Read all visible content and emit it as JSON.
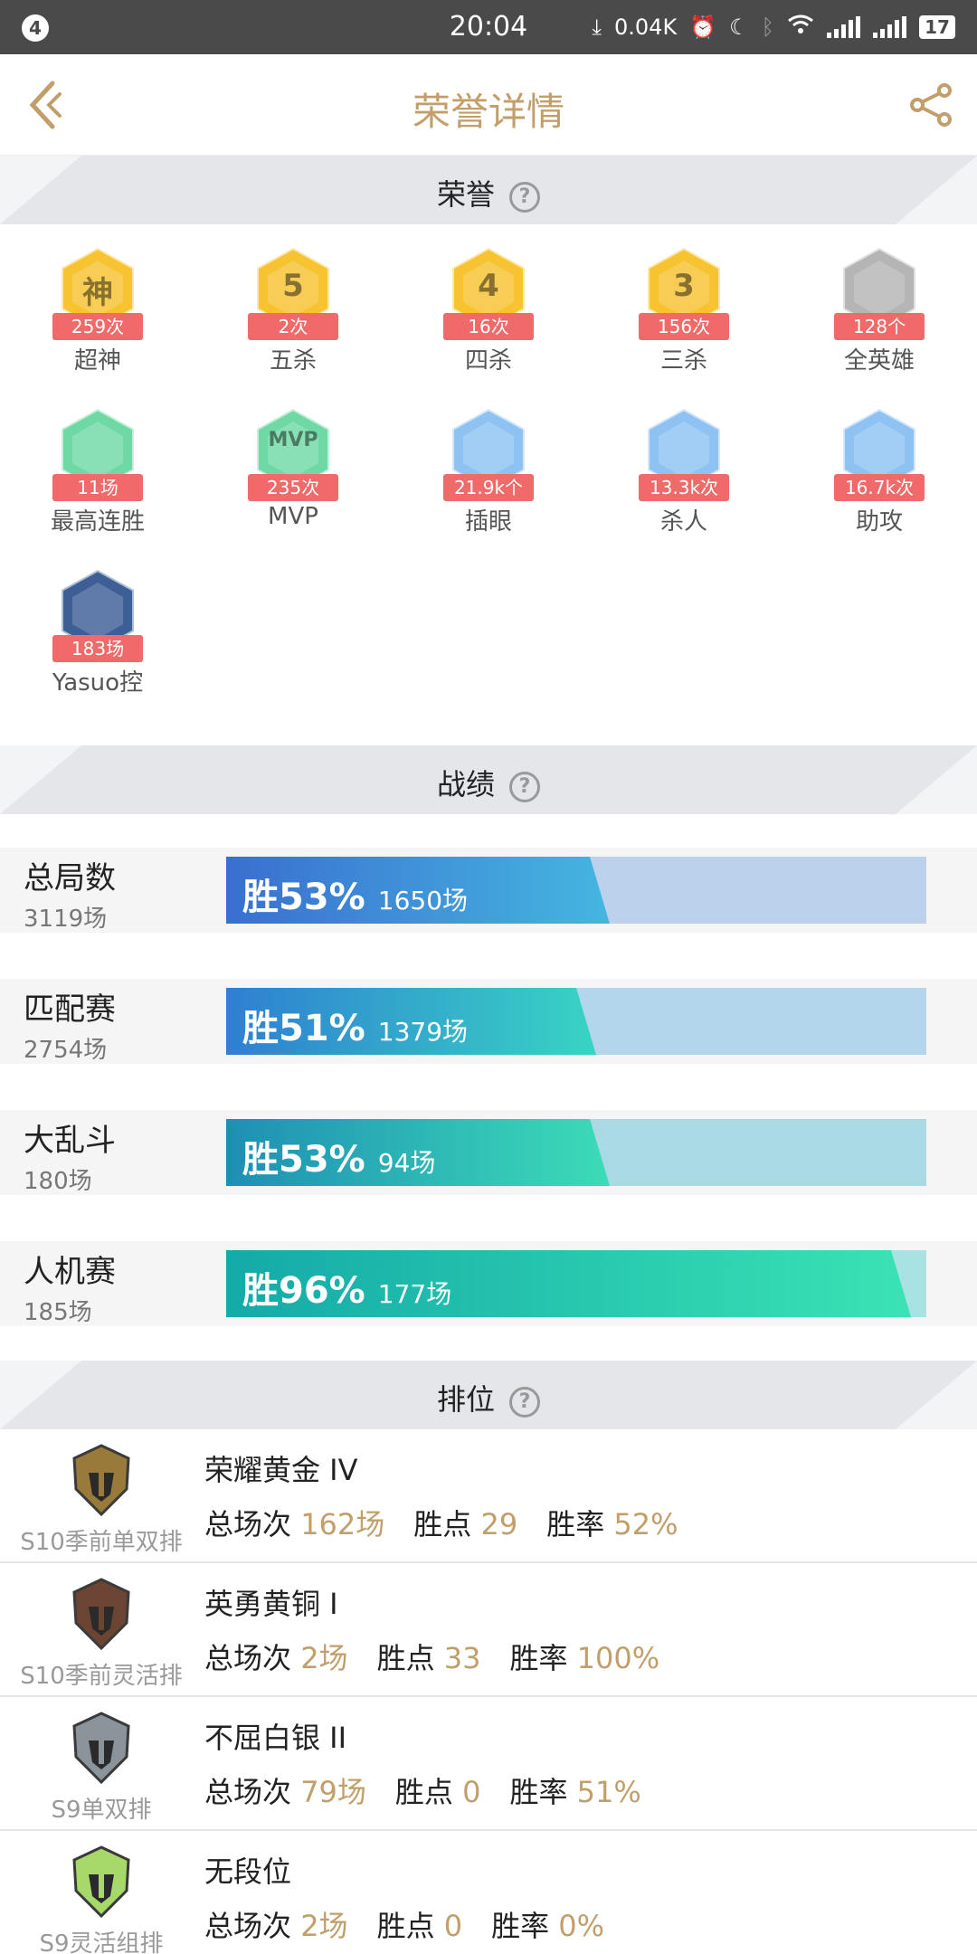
{
  "status_bar": {
    "notification_count": "4",
    "time": "20:04",
    "net_speed": "0.04K",
    "battery": "17",
    "icons": [
      "download-arrow-icon",
      "alarm-icon",
      "moon-icon",
      "bluetooth-icon",
      "wifi-icon",
      "signal-icon",
      "signal-icon",
      "battery-icon"
    ]
  },
  "header": {
    "title": "荣誉详情",
    "back_icon": "back-chevron-icon",
    "share_icon": "share-icon",
    "accent_color": "#c29f6a"
  },
  "sections": {
    "honors_title": "荣誉",
    "stats_title": "战绩",
    "ranked_title": "排位",
    "help_glyph": "?"
  },
  "honors": [
    {
      "label": "超神",
      "count": "259次",
      "glyph": "神",
      "color": "#f7c331"
    },
    {
      "label": "五杀",
      "count": "2次",
      "glyph": "5",
      "color": "#f7c331"
    },
    {
      "label": "四杀",
      "count": "16次",
      "glyph": "4",
      "color": "#f7c331"
    },
    {
      "label": "三杀",
      "count": "156次",
      "glyph": "3",
      "color": "#f7c331"
    },
    {
      "label": "全英雄",
      "count": "128个",
      "glyph": "",
      "color": "#b5b5b5"
    },
    {
      "label": "最高连胜",
      "count": "11场",
      "glyph": "",
      "color": "#6fd9a6"
    },
    {
      "label": "MVP",
      "count": "235次",
      "glyph": "MVP",
      "color": "#6fd9a6"
    },
    {
      "label": "插眼",
      "count": "21.9k个",
      "glyph": "",
      "color": "#8ec2f3"
    },
    {
      "label": "杀人",
      "count": "13.3k次",
      "glyph": "",
      "color": "#8ec2f3"
    },
    {
      "label": "助攻",
      "count": "16.7k次",
      "glyph": "",
      "color": "#8ec2f3"
    },
    {
      "label": "Yasuo控",
      "count": "183场",
      "glyph": "",
      "color": "#3d5f96"
    }
  ],
  "stats": [
    {
      "name": "总局数",
      "count": "3119场",
      "pct_label": "胜53%",
      "games": "1650场",
      "win_rate": 0.53,
      "fill_from": "#3a6fd0",
      "fill_to": "#45b6e0",
      "bg": "#bcd1ec"
    },
    {
      "name": "匹配赛",
      "count": "2754场",
      "pct_label": "胜51%",
      "games": "1379场",
      "win_rate": 0.51,
      "fill_from": "#2f7fd2",
      "fill_to": "#38d4c4",
      "bg": "#b4d6ec"
    },
    {
      "name": "大乱斗",
      "count": "180场",
      "pct_label": "胜53%",
      "games": "94场",
      "win_rate": 0.53,
      "fill_from": "#1e8fb4",
      "fill_to": "#3cdcb7",
      "bg": "#a9d9e3"
    },
    {
      "name": "人机赛",
      "count": "185场",
      "pct_label": "胜96%",
      "games": "177场",
      "win_rate": 0.96,
      "fill_from": "#14aaa8",
      "fill_to": "#3ae3b4",
      "bg": "#a9e2e2"
    }
  ],
  "ranked_labels": {
    "games": "总场次",
    "points": "胜点",
    "win_rate": "胜率"
  },
  "ranked": [
    {
      "queue": "S10季前单双排",
      "tier": "荣耀黄金 IV",
      "games": "162场",
      "points": "29",
      "win_rate": "52%",
      "emblem": "gold-helmet-emblem-icon"
    },
    {
      "queue": "S10季前灵活排",
      "tier": "英勇黄铜 I",
      "games": "2场",
      "points": "33",
      "win_rate": "100%",
      "emblem": "bronze-helmet-emblem-icon"
    },
    {
      "queue": "S9单双排",
      "tier": "不屈白银 II",
      "games": "79场",
      "points": "0",
      "win_rate": "51%",
      "emblem": "silver-wings-emblem-icon"
    },
    {
      "queue": "S9灵活组排",
      "tier": "无段位",
      "games": "2场",
      "points": "0",
      "win_rate": "0%",
      "emblem": "teemo-cat-emblem-icon"
    }
  ]
}
